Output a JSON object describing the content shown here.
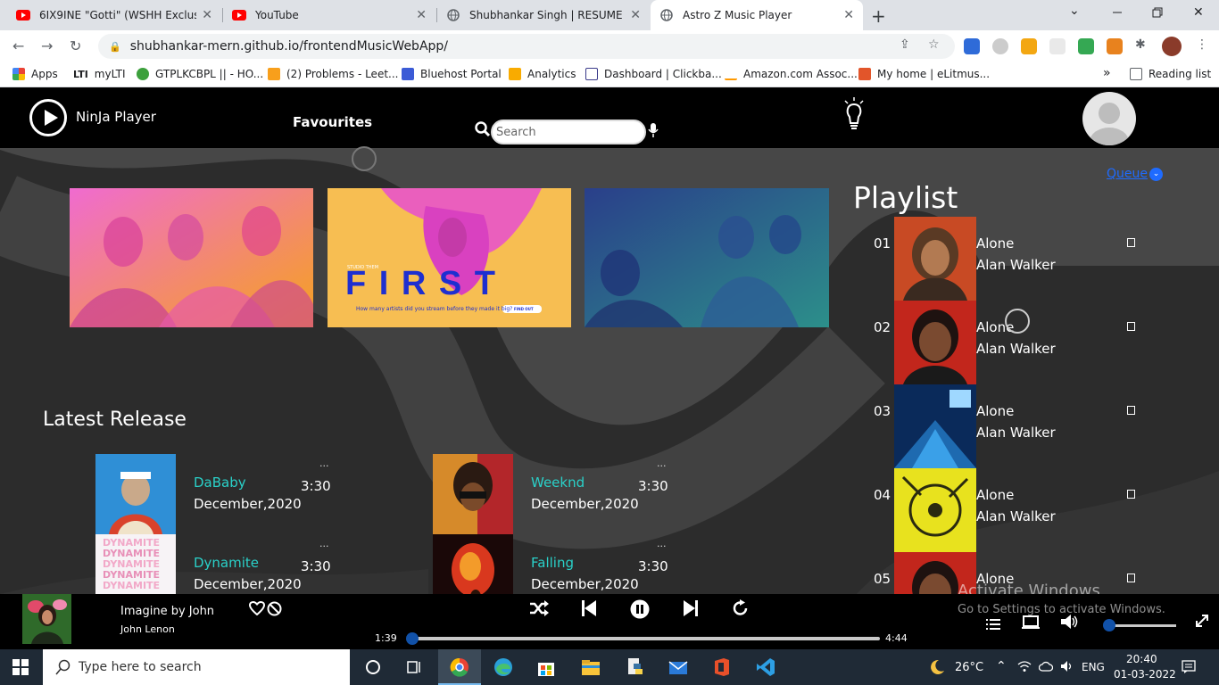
{
  "browser": {
    "tabs": [
      {
        "title": "6IX9INE \"Gotti\" (WSHH Exclusive",
        "icon": "youtube-icon"
      },
      {
        "title": "YouTube",
        "icon": "youtube-icon"
      },
      {
        "title": "Shubhankar Singh | RESUME",
        "icon": "globe-icon"
      },
      {
        "title": "Astro Z Music Player",
        "icon": "globe-icon",
        "active": true
      }
    ],
    "url": "shubhankar-mern.github.io/frontendMusicWebApp/",
    "bookmarks": [
      {
        "label": "Apps"
      },
      {
        "label": "myLTI",
        "prefix": "LTI"
      },
      {
        "label": "GTPLKCBPL || - HO..."
      },
      {
        "label": "(2) Problems - Leet..."
      },
      {
        "label": "Bluehost Portal"
      },
      {
        "label": "Analytics"
      },
      {
        "label": "Dashboard | Clickba..."
      },
      {
        "label": "Amazon.com Assoc..."
      },
      {
        "label": "My home | eLitmus..."
      }
    ],
    "reading_list": "Reading list",
    "more": "»"
  },
  "app": {
    "brand": "NinJa Player",
    "nav_favourites": "Favourites",
    "search_placeholder": "Search",
    "banners": [
      {
        "name": "party-crowd"
      },
      {
        "name": "first-promo",
        "big_text": "F I R S T",
        "small_top": "STUDIO THEM",
        "small_bottom": "How many artists did you stream before they made it big?",
        "cta": "FIND OUT"
      },
      {
        "name": "gaming-friends"
      }
    ],
    "latest_release_title": "Latest Release",
    "releases": [
      {
        "name": "DaBaby",
        "date": "December,2020",
        "duration": "3:30",
        "more": "..."
      },
      {
        "name": "Weeknd",
        "date": "December,2020",
        "duration": "3:30",
        "more": "..."
      },
      {
        "name": "Dynamite",
        "date": "December,2020",
        "duration": "3:30",
        "more": "...",
        "cover_text": "DYNAMITE"
      },
      {
        "name": "Falling",
        "date": "December,2020",
        "duration": "3:30",
        "more": "..."
      }
    ],
    "playlist_title": "Playlist",
    "queue_label": "Queue",
    "playlist": [
      {
        "num": "01",
        "title": "Alone",
        "artist": "Alan Walker"
      },
      {
        "num": "02",
        "title": "Alone",
        "artist": "Alan Walker"
      },
      {
        "num": "03",
        "title": "Alone",
        "artist": "Alan Walker"
      },
      {
        "num": "04",
        "title": "Alone",
        "artist": "Alan Walker"
      },
      {
        "num": "05",
        "title": "Alone",
        "artist": ""
      }
    ],
    "now_playing": {
      "title": "Imagine by John",
      "artist": "John Lenon",
      "elapsed": "1:39",
      "total": "4:44",
      "progress": 0.0
    },
    "watermark": {
      "line1": "Activate Windows",
      "line2": "Go to Settings to activate Windows."
    },
    "colors": {
      "accent": "#2ad1c9",
      "link": "#1e6bff",
      "knob": "#1151a8"
    }
  },
  "taskbar": {
    "search_placeholder": "Type here to search",
    "temperature": "26°C",
    "lang": "ENG",
    "time": "20:40",
    "date": "01-03-2022"
  }
}
